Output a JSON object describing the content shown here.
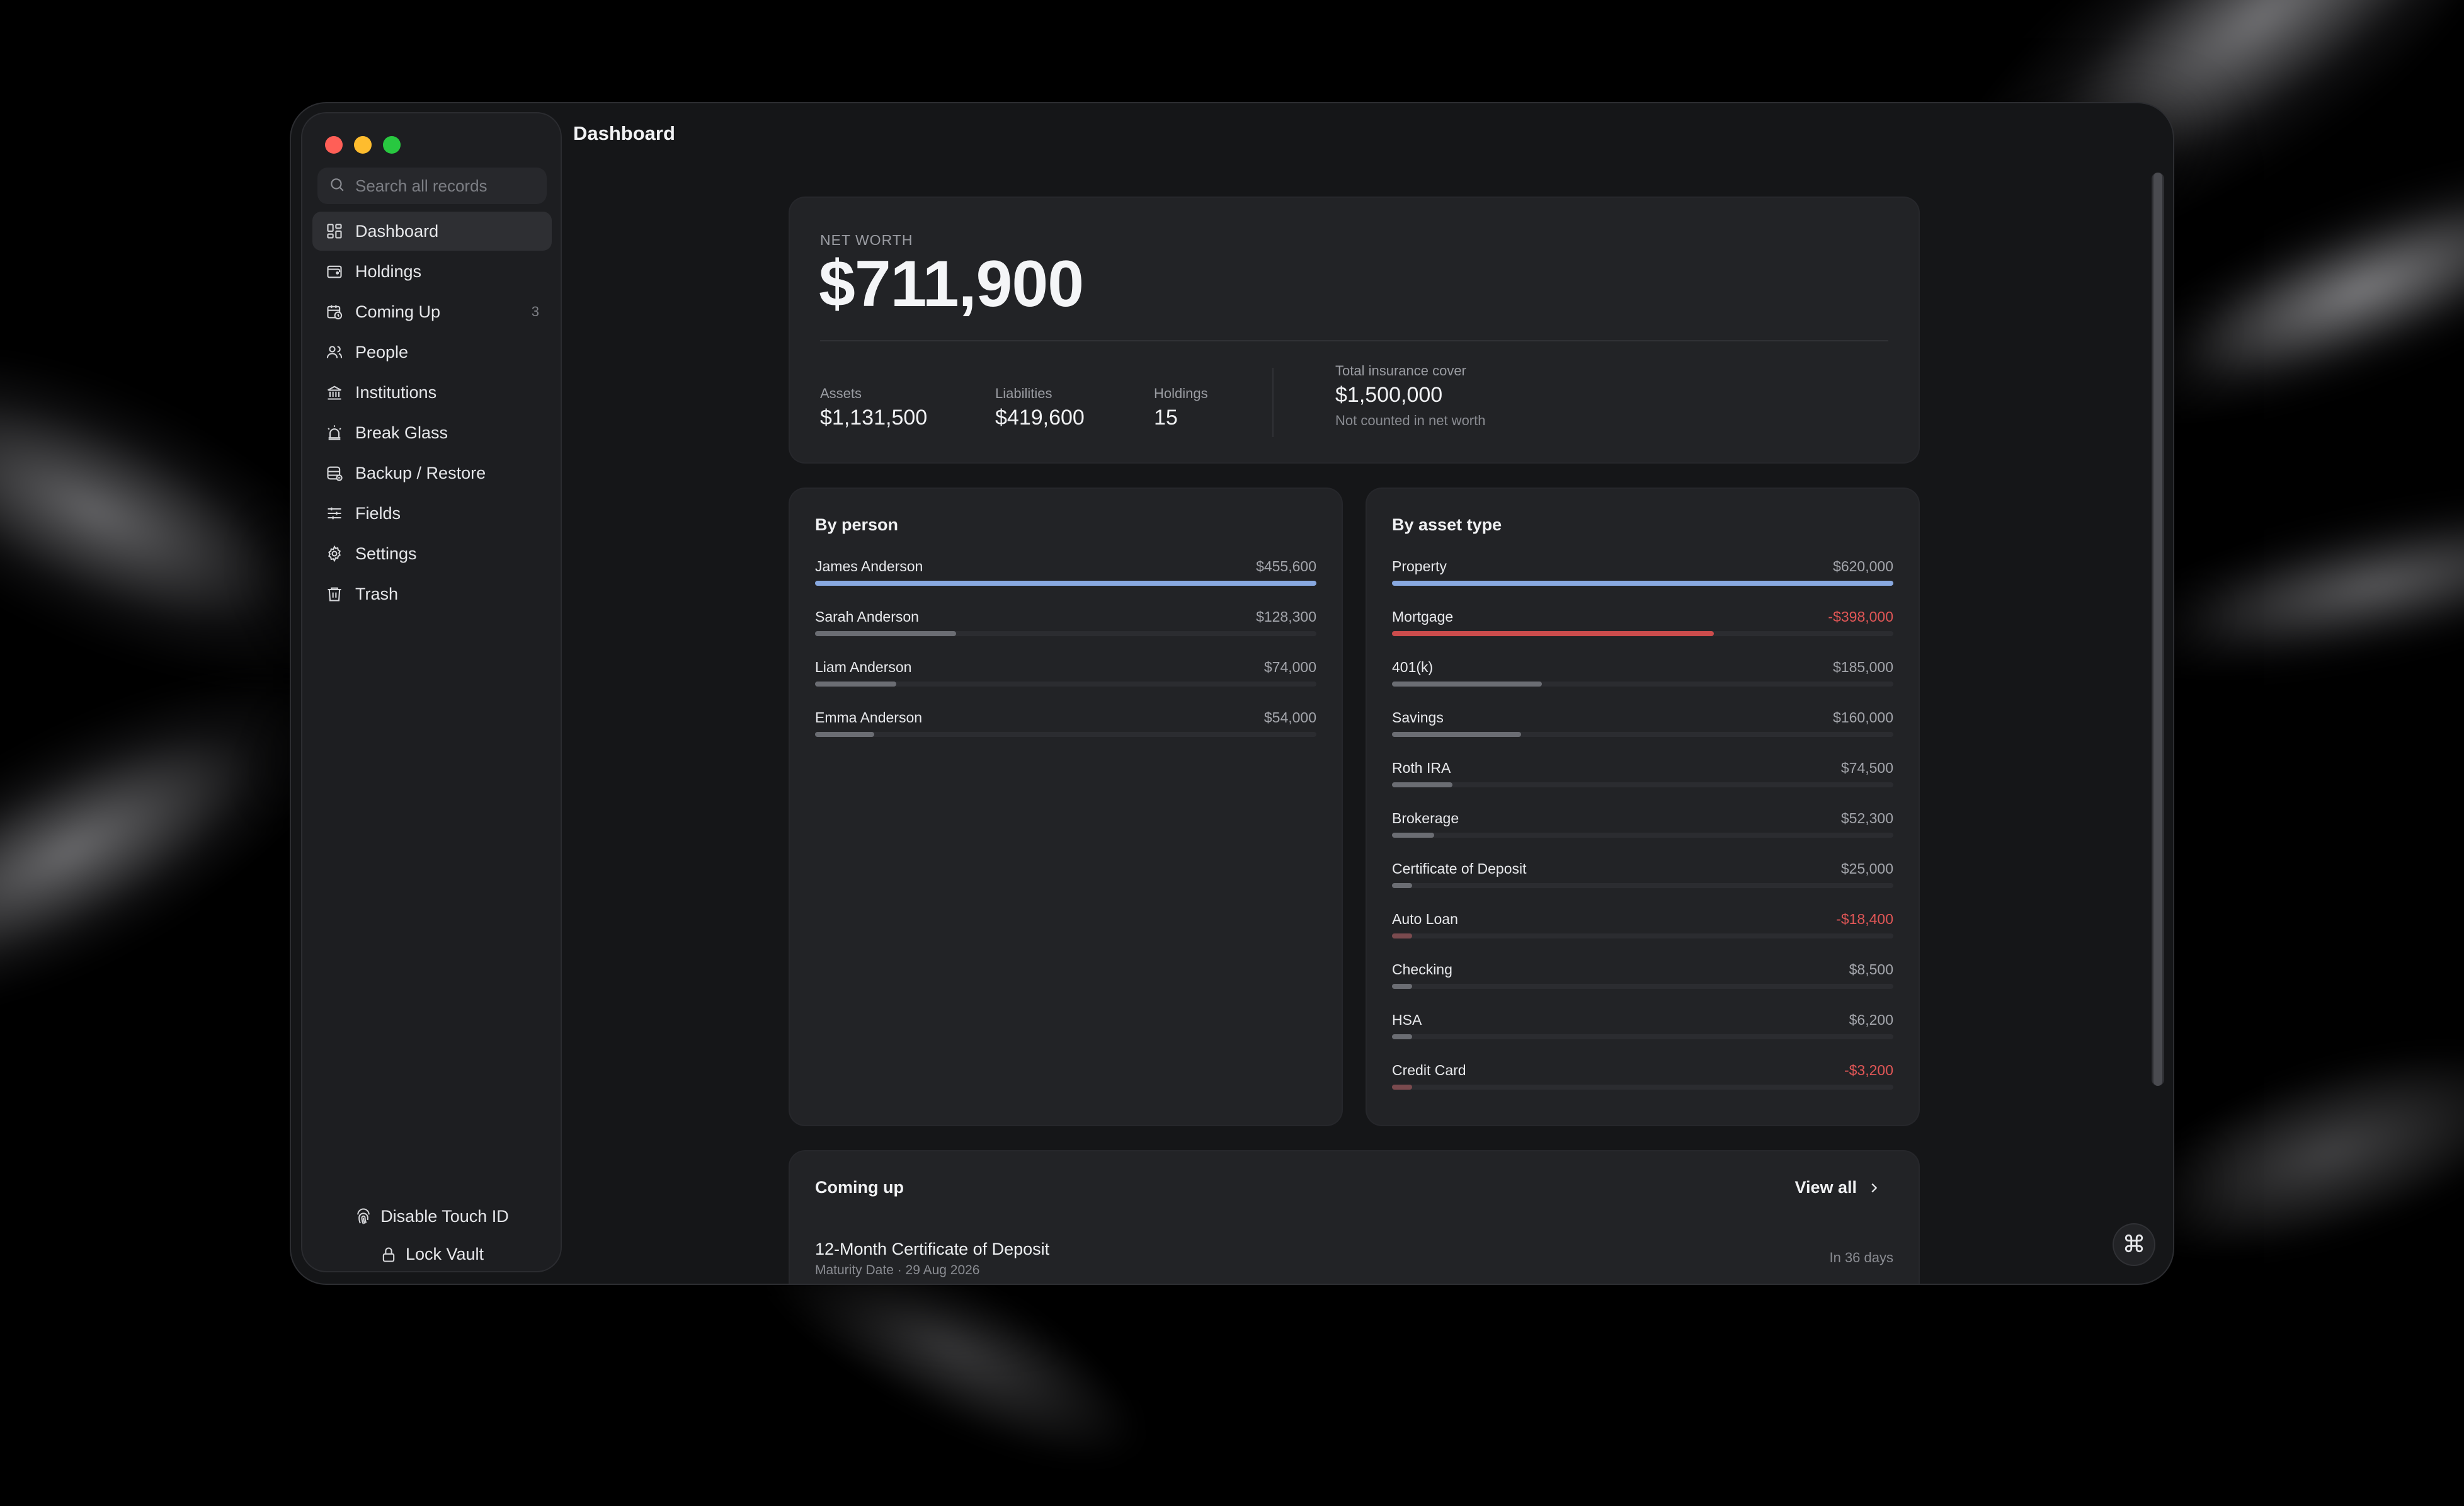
{
  "window": {
    "title": "Dashboard"
  },
  "sidebar": {
    "search": {
      "placeholder": "Search all records"
    },
    "items": [
      {
        "label": "Dashboard",
        "icon": "dashboard-icon",
        "active": true
      },
      {
        "label": "Holdings",
        "icon": "wallet-icon"
      },
      {
        "label": "Coming Up",
        "icon": "calendar-clock-icon",
        "count": "3"
      },
      {
        "label": "People",
        "icon": "people-icon"
      },
      {
        "label": "Institutions",
        "icon": "bank-icon"
      },
      {
        "label": "Break Glass",
        "icon": "alarm-icon"
      },
      {
        "label": "Backup / Restore",
        "icon": "database-icon"
      },
      {
        "label": "Fields",
        "icon": "sliders-icon"
      },
      {
        "label": "Settings",
        "icon": "gear-icon"
      },
      {
        "label": "Trash",
        "icon": "trash-icon"
      }
    ],
    "footer": {
      "touch_id_label": "Disable Touch ID",
      "lock_label": "Lock Vault"
    }
  },
  "net_worth": {
    "label": "NET WORTH",
    "value": "$711,900",
    "assets_label": "Assets",
    "assets_value": "$1,131,500",
    "liabilities_label": "Liabilities",
    "liabilities_value": "$419,600",
    "holdings_label": "Holdings",
    "holdings_value": "15",
    "insurance_label": "Total insurance cover",
    "insurance_value": "$1,500,000",
    "insurance_note": "Not counted in net worth"
  },
  "by_person": {
    "title": "By person",
    "rows": [
      {
        "name": "James Anderson",
        "value": "$455,600",
        "amount": 455600
      },
      {
        "name": "Sarah Anderson",
        "value": "$128,300",
        "amount": 128300
      },
      {
        "name": "Liam Anderson",
        "value": "$74,000",
        "amount": 74000
      },
      {
        "name": "Emma Anderson",
        "value": "$54,000",
        "amount": 54000
      }
    ]
  },
  "by_asset_type": {
    "title": "By asset type",
    "rows": [
      {
        "name": "Property",
        "value": "$620,000",
        "amount": 620000,
        "negative": false
      },
      {
        "name": "Mortgage",
        "value": "-$398,000",
        "amount": 398000,
        "negative": true
      },
      {
        "name": "401(k)",
        "value": "$185,000",
        "amount": 185000,
        "negative": false
      },
      {
        "name": "Savings",
        "value": "$160,000",
        "amount": 160000,
        "negative": false
      },
      {
        "name": "Roth IRA",
        "value": "$74,500",
        "amount": 74500,
        "negative": false
      },
      {
        "name": "Brokerage",
        "value": "$52,300",
        "amount": 52300,
        "negative": false
      },
      {
        "name": "Certificate of Deposit",
        "value": "$25,000",
        "amount": 25000,
        "negative": false
      },
      {
        "name": "Auto Loan",
        "value": "-$18,400",
        "amount": 18400,
        "negative": true
      },
      {
        "name": "Checking",
        "value": "$8,500",
        "amount": 8500,
        "negative": false
      },
      {
        "name": "HSA",
        "value": "$6,200",
        "amount": 6200,
        "negative": false
      },
      {
        "name": "Credit Card",
        "value": "-$3,200",
        "amount": 3200,
        "negative": true
      }
    ]
  },
  "coming_up": {
    "title": "Coming up",
    "view_all": "View all",
    "items": [
      {
        "title": "12-Month Certificate of Deposit",
        "subtitle": "Maturity Date · 29 Aug 2026",
        "due": "In 36 days"
      }
    ]
  },
  "colors": {
    "accent_bar": "#88a8e0",
    "negative": "#e05656",
    "window_bg": "#151618",
    "card_bg": "#222326"
  }
}
